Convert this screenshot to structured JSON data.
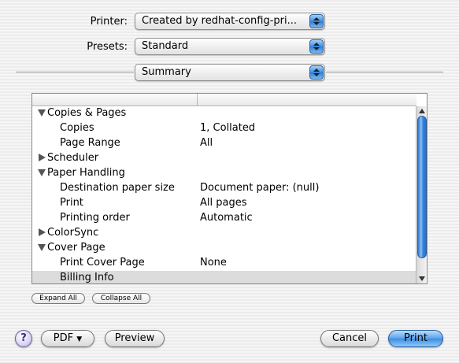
{
  "printer": {
    "label": "Printer:",
    "value": "Created by redhat-config-pri..."
  },
  "presets": {
    "label": "Presets:",
    "value": "Standard"
  },
  "panel": {
    "value": "Summary"
  },
  "summary_rows": [
    {
      "label": "Copies & Pages",
      "value": "",
      "level": 0,
      "expanded": true
    },
    {
      "label": "Copies",
      "value": "1, Collated",
      "level": 1
    },
    {
      "label": "Page Range",
      "value": "All",
      "level": 1
    },
    {
      "label": "Scheduler",
      "value": "",
      "level": 0,
      "expanded": false
    },
    {
      "label": "Paper Handling",
      "value": "",
      "level": 0,
      "expanded": true
    },
    {
      "label": "Destination paper size",
      "value": "Document paper: (null)",
      "level": 1
    },
    {
      "label": "Print",
      "value": "All pages",
      "level": 1
    },
    {
      "label": "Printing order",
      "value": "Automatic",
      "level": 1
    },
    {
      "label": "ColorSync",
      "value": "",
      "level": 0,
      "expanded": false
    },
    {
      "label": "Cover Page",
      "value": "",
      "level": 0,
      "expanded": true
    },
    {
      "label": "Print Cover Page",
      "value": "None",
      "level": 1
    },
    {
      "label": "Billing Info",
      "value": "",
      "level": 1,
      "selected": true
    }
  ],
  "outline_buttons": {
    "expand_all": "Expand All",
    "collapse_all": "Collapse All"
  },
  "footer": {
    "help": "?",
    "pdf": "PDF",
    "pdf_arrow": "▼",
    "preview": "Preview",
    "cancel": "Cancel",
    "print": "Print"
  },
  "colors": {
    "accent": "#3d8be0",
    "selection": "#dcdcdc"
  }
}
